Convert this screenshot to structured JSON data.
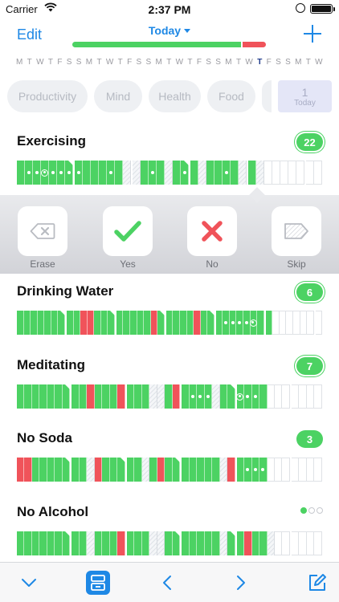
{
  "status": {
    "carrier": "Carrier",
    "time": "2:37 PM"
  },
  "nav": {
    "edit_label": "Edit",
    "title": "Today",
    "progress_green_pct": 87
  },
  "days": [
    "M",
    "T",
    "W",
    "T",
    "F",
    "S",
    "S",
    "M",
    "T",
    "W",
    "T",
    "F",
    "S",
    "S",
    "M",
    "T",
    "W",
    "T",
    "F",
    "S",
    "S",
    "M",
    "T",
    "W",
    "T",
    "F",
    "S",
    "S",
    "M",
    "T",
    "W"
  ],
  "current_day_index": 24,
  "categories": [
    "Productivity",
    "Mind",
    "Health",
    "Food"
  ],
  "today_chip": {
    "number": "1",
    "label": "Today"
  },
  "actions": [
    {
      "label": "Erase",
      "icon": "erase-icon"
    },
    {
      "label": "Yes",
      "icon": "checkmark-icon"
    },
    {
      "label": "No",
      "icon": "x-icon"
    },
    {
      "label": "Skip",
      "icon": "skip-tag-icon"
    }
  ],
  "habits": [
    {
      "name": "Exercising",
      "badge": "22",
      "cells": "g,g,g,g,g,g,g,g,g,g|g,g,g,s,s,g,g,g,s,g,g,g,s,g,g,g,g,s,g,s,e,e,e,e,e,e,e"
    },
    {
      "name": "Drinking Water",
      "badge": "6",
      "cells": "g,g,g,g,g,g,g,g,g,r,r,g,g,g,g,g,g,g,g,r,g,g,g,g,g,r,g,g,g,g,g,g,g,g,g,g,e,e,e,e,e,e,e"
    },
    {
      "name": "Meditating",
      "badge": "7",
      "cells": "g,g,g,g,g,g,g,g,g,r,g,g,g,r,g,g,g,s,s,g,r,g,g,g,g,s,g,g,g,g,g,g,e,e,e,e,e,e,e"
    },
    {
      "name": "No Soda",
      "badge": "3",
      "cells": "r,r,g,g,g,g,g,g,g,s,r,g,g,g,g,g,s,g,r,g,g,g,g,g,g,g,s,r,g,g,g,g,e,e,e,e,e,e,e"
    },
    {
      "name": "No Alcohol",
      "badge": "",
      "cells": "g,g,g,g,g,g,g,g,g,s,g,g,g,r,g,g,g,s,s,g,g,g,g,g,g,g,s,g,g,r,g,g,s,e,e,e,e,e,e"
    }
  ],
  "colors": {
    "accent": "#1e88e5",
    "green": "#4cd263",
    "red": "#f0535a"
  },
  "toolbar": [
    {
      "icon": "chevron-down-icon"
    },
    {
      "icon": "archive-box-icon"
    },
    {
      "icon": "chevron-left-icon"
    },
    {
      "icon": "chevron-right-icon"
    },
    {
      "icon": "compose-icon"
    }
  ]
}
